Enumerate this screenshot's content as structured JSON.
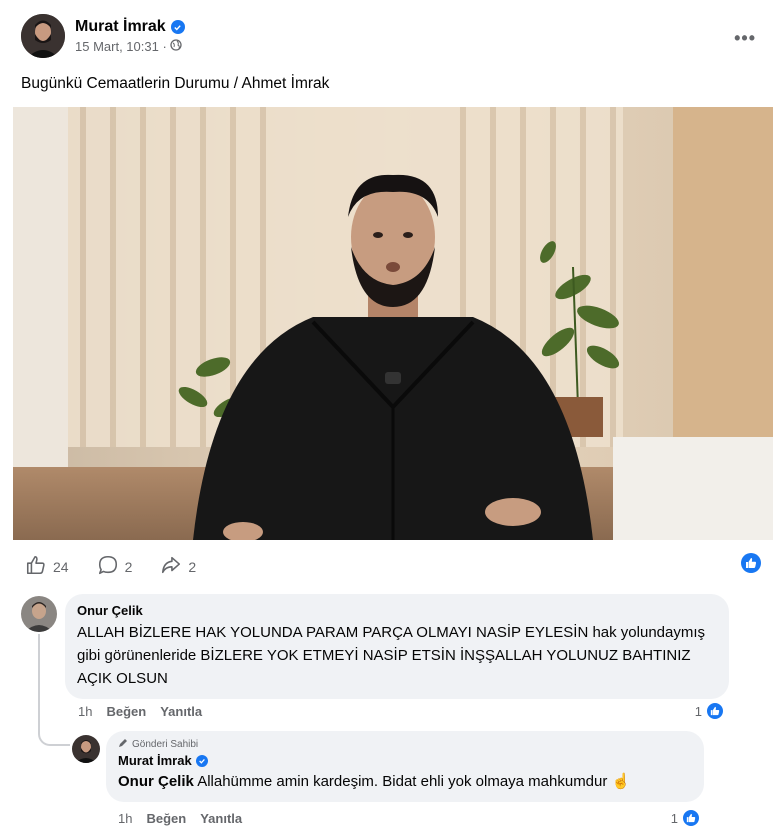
{
  "post": {
    "author": "Murat İmrak",
    "time": "15 Mart, 10:31 ·",
    "text": "Bugünkü Cemaatlerin Durumu / Ahmet İmrak",
    "more_label": "•••"
  },
  "stats": {
    "likes": "24",
    "comments": "2",
    "shares": "2"
  },
  "comments": [
    {
      "author": "Onur Çelik",
      "text": "ALLAH BİZLERE HAK YOLUNDA PARAM PARÇA OLMAYI NASİP EYLESİN hak yolundaymış gibi görünenleride BİZLERE YOK ETMEYİ NASİP ETSİN İNŞŞALLAH YOLUNUZ BAHTINIZ AÇIK OLSUN",
      "time": "1h",
      "like_label": "Beğen",
      "reply_label": "Yanıtla",
      "like_count": "1"
    }
  ],
  "reply": {
    "badge": "Gönderi Sahibi",
    "author": "Murat İmrak",
    "mention": "Onur Çelik",
    "text": " Allahümme amin kardeşim. Bidat ehli yok olmaya mahkumdur ☝",
    "time": "1h",
    "like_label": "Beğen",
    "reply_label": "Yanıtla",
    "like_count": "1"
  },
  "colors": {
    "accent": "#1877f2",
    "bubble": "#f0f2f5",
    "secondary_text": "#65676b"
  }
}
